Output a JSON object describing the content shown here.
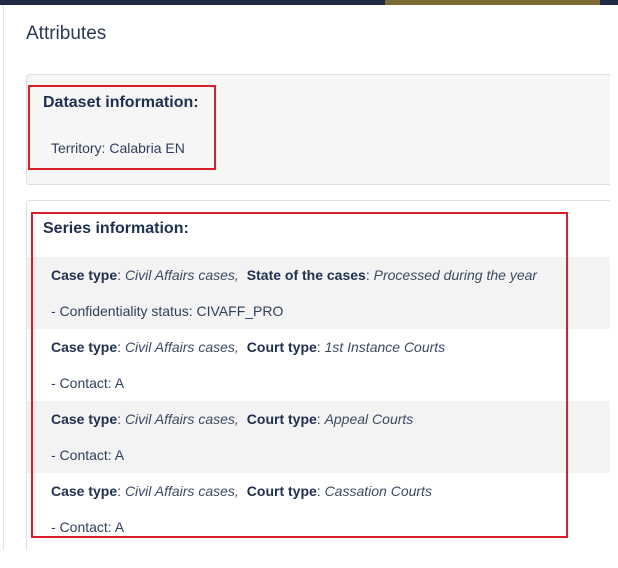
{
  "dialog": {
    "title": "Attributes"
  },
  "dataset": {
    "heading": "Dataset information:",
    "territory_label": "Territory:",
    "territory_value": "Calabria EN"
  },
  "series": {
    "heading": "Series information:",
    "rows": [
      {
        "k1": "Case type",
        "v1": "Civil Affairs cases,",
        "k2": "State of the cases",
        "v2": "Processed during the year",
        "detail": "- Confidentiality status: CIVAFF_PRO"
      },
      {
        "k1": "Case type",
        "v1": "Civil Affairs cases,",
        "k2": "Court type",
        "v2": "1st Instance Courts",
        "detail": "- Contact: A"
      },
      {
        "k1": "Case type",
        "v1": "Civil Affairs cases,",
        "k2": "Court type",
        "v2": "Appeal Courts",
        "detail": "- Contact: A"
      },
      {
        "k1": "Case type",
        "v1": "Civil Affairs cases,",
        "k2": "Court type",
        "v2": "Cassation Courts",
        "detail": "- Contact: A"
      }
    ]
  },
  "colors": {
    "highlight": "#d9202a",
    "heading": "#1d3050",
    "text": "#2e3f5c"
  }
}
